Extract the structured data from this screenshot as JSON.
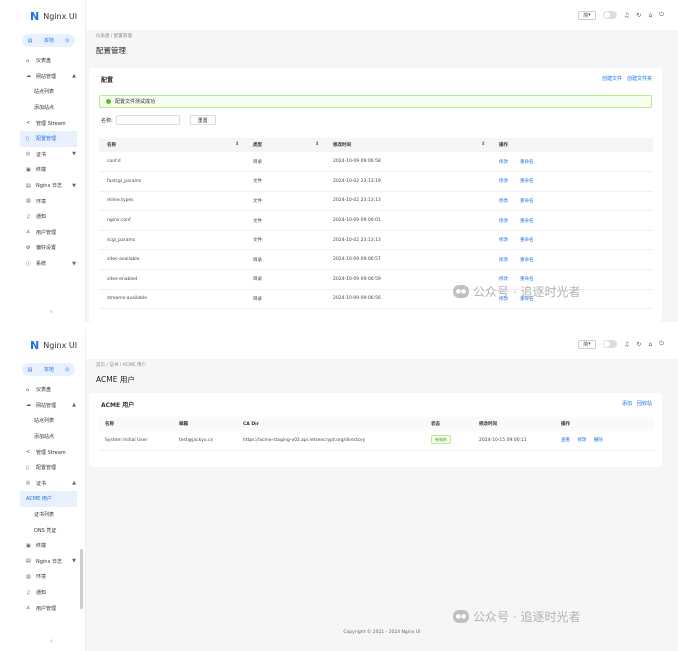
{
  "app": {
    "logo_letter": "N",
    "title": "Nginx UI"
  },
  "env": {
    "label": "本地",
    "badge": "⊙"
  },
  "watermark": {
    "text": "公众号 · 追逐时光者"
  },
  "screen1": {
    "nav": [
      {
        "icon": "home-icon",
        "glyph": "⌂",
        "label": "仪表盘"
      },
      {
        "icon": "cloud-icon",
        "glyph": "☁",
        "label": "网站管理",
        "arrow": "▲"
      },
      {
        "label": "站点列表",
        "sub": true
      },
      {
        "label": "添加站点",
        "sub": true
      },
      {
        "icon": "share-icon",
        "glyph": "≺",
        "label": "管理 Stream"
      },
      {
        "icon": "file-icon",
        "glyph": "▯",
        "label": "配置管理",
        "active": true
      },
      {
        "icon": "cert-icon",
        "glyph": "◎",
        "label": "证书",
        "arrow": "▼"
      },
      {
        "icon": "terminal-icon",
        "glyph": "▣",
        "label": "终端"
      },
      {
        "icon": "log-icon",
        "glyph": "▤",
        "label": "Nginx 日志",
        "arrow": "▼"
      },
      {
        "icon": "env-icon",
        "glyph": "▥",
        "label": "环境"
      },
      {
        "icon": "bell-icon",
        "glyph": "♫",
        "label": "通知"
      },
      {
        "icon": "user-icon",
        "glyph": "♙",
        "label": "用户管理"
      },
      {
        "icon": "settings-icon",
        "glyph": "⚙",
        "label": "偏好设置"
      },
      {
        "icon": "info-icon",
        "glyph": "ⓘ",
        "label": "系统",
        "arrow": "▼"
      }
    ],
    "breadcrumb": "仪表盘 / 配置管理",
    "page_title": "配置管理",
    "card_title": "配置",
    "actions": [
      "创建文件",
      "创建文件夹"
    ],
    "alert": "配置文件测试成功",
    "search_label": "名称:",
    "reset_label": "重置",
    "columns": [
      "名称",
      "类型",
      "修改时间",
      "操作"
    ],
    "rows": [
      {
        "name": "conf.d",
        "type": "目录",
        "time": "2024-10-09 09:06:58"
      },
      {
        "name": "fastcgi_params",
        "type": "文件",
        "time": "2024-10-02 23:13:19"
      },
      {
        "name": "mime.types",
        "type": "文件",
        "time": "2024-10-02 23:13:13"
      },
      {
        "name": "nginx.conf",
        "type": "文件",
        "time": "2024-10-09 09:06:01"
      },
      {
        "name": "scgi_params",
        "type": "文件",
        "time": "2024-10-02 23:13:13"
      },
      {
        "name": "sites-available",
        "type": "目录",
        "time": "2024-10-09 09:06:57"
      },
      {
        "name": "sites-enabled",
        "type": "目录",
        "time": "2024-10-09 09:06:59"
      },
      {
        "name": "streams-available",
        "type": "目录",
        "time": "2024-10-09 09:06:56"
      }
    ],
    "row_actions": [
      "修改",
      "重命名"
    ]
  },
  "screen2": {
    "nav": [
      {
        "icon": "home-icon",
        "glyph": "⌂",
        "label": "仪表盘"
      },
      {
        "icon": "cloud-icon",
        "glyph": "☁",
        "label": "网站管理",
        "arrow": "▲"
      },
      {
        "label": "站点列表",
        "sub": true
      },
      {
        "label": "添加站点",
        "sub": true
      },
      {
        "icon": "share-icon",
        "glyph": "≺",
        "label": "管理 Stream"
      },
      {
        "icon": "file-icon",
        "glyph": "▯",
        "label": "配置管理"
      },
      {
        "icon": "cert-icon",
        "glyph": "◎",
        "label": "证书",
        "arrow": "▲"
      },
      {
        "label": "ACME 用户",
        "sub": true,
        "active": true
      },
      {
        "label": "证书列表",
        "sub": true
      },
      {
        "label": "DNS 凭证",
        "sub": true
      },
      {
        "icon": "terminal-icon",
        "glyph": "▣",
        "label": "终端"
      },
      {
        "icon": "log-icon",
        "glyph": "▤",
        "label": "Nginx 日志",
        "arrow": "▼"
      },
      {
        "icon": "env-icon",
        "glyph": "▥",
        "label": "环境"
      },
      {
        "icon": "bell-icon",
        "glyph": "♫",
        "label": "通知"
      },
      {
        "icon": "user-icon",
        "glyph": "♙",
        "label": "用户管理"
      }
    ],
    "breadcrumb": "首页 / 证书 / ACME 用户",
    "page_title": "ACME 用户",
    "card_title": "ACME 用户",
    "actions": [
      "添加",
      "回收站"
    ],
    "columns": [
      "名称",
      "邮箱",
      "CA Dir",
      "状态",
      "修改时间",
      "操作"
    ],
    "rows": [
      {
        "name": "System Initial User",
        "email": "test@jackyu.cn",
        "ca": "https://acme-staging-v02.api.letsencrypt.org/directory",
        "status": "有效的",
        "time": "2024-10-15 09:00:11"
      }
    ],
    "row_actions": [
      "查看",
      "修改",
      "删除"
    ],
    "footer": "Copyright © 2021 - 2024 Nginx UI"
  },
  "topbar": {
    "lang": "简",
    "icons": [
      "bell-icon",
      "reload-icon",
      "home-icon",
      "logout-icon"
    ]
  }
}
